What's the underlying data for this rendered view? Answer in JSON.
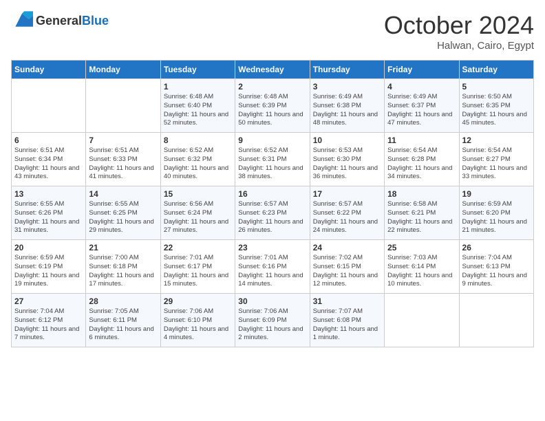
{
  "header": {
    "logo_general": "General",
    "logo_blue": "Blue",
    "title": "October 2024",
    "location": "Halwan, Cairo, Egypt"
  },
  "weekdays": [
    "Sunday",
    "Monday",
    "Tuesday",
    "Wednesday",
    "Thursday",
    "Friday",
    "Saturday"
  ],
  "weeks": [
    [
      {
        "day": "",
        "content": ""
      },
      {
        "day": "",
        "content": ""
      },
      {
        "day": "1",
        "content": "Sunrise: 6:48 AM\nSunset: 6:40 PM\nDaylight: 11 hours and 52 minutes."
      },
      {
        "day": "2",
        "content": "Sunrise: 6:48 AM\nSunset: 6:39 PM\nDaylight: 11 hours and 50 minutes."
      },
      {
        "day": "3",
        "content": "Sunrise: 6:49 AM\nSunset: 6:38 PM\nDaylight: 11 hours and 48 minutes."
      },
      {
        "day": "4",
        "content": "Sunrise: 6:49 AM\nSunset: 6:37 PM\nDaylight: 11 hours and 47 minutes."
      },
      {
        "day": "5",
        "content": "Sunrise: 6:50 AM\nSunset: 6:35 PM\nDaylight: 11 hours and 45 minutes."
      }
    ],
    [
      {
        "day": "6",
        "content": "Sunrise: 6:51 AM\nSunset: 6:34 PM\nDaylight: 11 hours and 43 minutes."
      },
      {
        "day": "7",
        "content": "Sunrise: 6:51 AM\nSunset: 6:33 PM\nDaylight: 11 hours and 41 minutes."
      },
      {
        "day": "8",
        "content": "Sunrise: 6:52 AM\nSunset: 6:32 PM\nDaylight: 11 hours and 40 minutes."
      },
      {
        "day": "9",
        "content": "Sunrise: 6:52 AM\nSunset: 6:31 PM\nDaylight: 11 hours and 38 minutes."
      },
      {
        "day": "10",
        "content": "Sunrise: 6:53 AM\nSunset: 6:30 PM\nDaylight: 11 hours and 36 minutes."
      },
      {
        "day": "11",
        "content": "Sunrise: 6:54 AM\nSunset: 6:28 PM\nDaylight: 11 hours and 34 minutes."
      },
      {
        "day": "12",
        "content": "Sunrise: 6:54 AM\nSunset: 6:27 PM\nDaylight: 11 hours and 33 minutes."
      }
    ],
    [
      {
        "day": "13",
        "content": "Sunrise: 6:55 AM\nSunset: 6:26 PM\nDaylight: 11 hours and 31 minutes."
      },
      {
        "day": "14",
        "content": "Sunrise: 6:55 AM\nSunset: 6:25 PM\nDaylight: 11 hours and 29 minutes."
      },
      {
        "day": "15",
        "content": "Sunrise: 6:56 AM\nSunset: 6:24 PM\nDaylight: 11 hours and 27 minutes."
      },
      {
        "day": "16",
        "content": "Sunrise: 6:57 AM\nSunset: 6:23 PM\nDaylight: 11 hours and 26 minutes."
      },
      {
        "day": "17",
        "content": "Sunrise: 6:57 AM\nSunset: 6:22 PM\nDaylight: 11 hours and 24 minutes."
      },
      {
        "day": "18",
        "content": "Sunrise: 6:58 AM\nSunset: 6:21 PM\nDaylight: 11 hours and 22 minutes."
      },
      {
        "day": "19",
        "content": "Sunrise: 6:59 AM\nSunset: 6:20 PM\nDaylight: 11 hours and 21 minutes."
      }
    ],
    [
      {
        "day": "20",
        "content": "Sunrise: 6:59 AM\nSunset: 6:19 PM\nDaylight: 11 hours and 19 minutes."
      },
      {
        "day": "21",
        "content": "Sunrise: 7:00 AM\nSunset: 6:18 PM\nDaylight: 11 hours and 17 minutes."
      },
      {
        "day": "22",
        "content": "Sunrise: 7:01 AM\nSunset: 6:17 PM\nDaylight: 11 hours and 15 minutes."
      },
      {
        "day": "23",
        "content": "Sunrise: 7:01 AM\nSunset: 6:16 PM\nDaylight: 11 hours and 14 minutes."
      },
      {
        "day": "24",
        "content": "Sunrise: 7:02 AM\nSunset: 6:15 PM\nDaylight: 11 hours and 12 minutes."
      },
      {
        "day": "25",
        "content": "Sunrise: 7:03 AM\nSunset: 6:14 PM\nDaylight: 11 hours and 10 minutes."
      },
      {
        "day": "26",
        "content": "Sunrise: 7:04 AM\nSunset: 6:13 PM\nDaylight: 11 hours and 9 minutes."
      }
    ],
    [
      {
        "day": "27",
        "content": "Sunrise: 7:04 AM\nSunset: 6:12 PM\nDaylight: 11 hours and 7 minutes."
      },
      {
        "day": "28",
        "content": "Sunrise: 7:05 AM\nSunset: 6:11 PM\nDaylight: 11 hours and 6 minutes."
      },
      {
        "day": "29",
        "content": "Sunrise: 7:06 AM\nSunset: 6:10 PM\nDaylight: 11 hours and 4 minutes."
      },
      {
        "day": "30",
        "content": "Sunrise: 7:06 AM\nSunset: 6:09 PM\nDaylight: 11 hours and 2 minutes."
      },
      {
        "day": "31",
        "content": "Sunrise: 7:07 AM\nSunset: 6:08 PM\nDaylight: 11 hours and 1 minute."
      },
      {
        "day": "",
        "content": ""
      },
      {
        "day": "",
        "content": ""
      }
    ]
  ]
}
